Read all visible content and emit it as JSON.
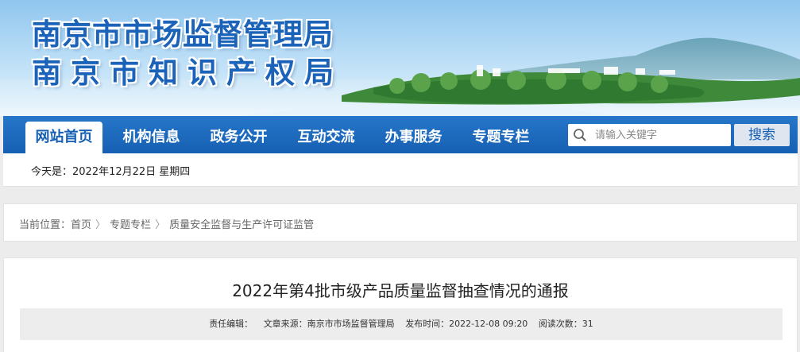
{
  "header": {
    "title_line1": "南京市市场监督管理局",
    "title_line2": "南京市知识产权局"
  },
  "nav": {
    "items": [
      {
        "label": "网站首页",
        "active": true
      },
      {
        "label": "机构信息",
        "active": false
      },
      {
        "label": "政务公开",
        "active": false
      },
      {
        "label": "互动交流",
        "active": false
      },
      {
        "label": "办事服务",
        "active": false
      },
      {
        "label": "专题专栏",
        "active": false
      }
    ],
    "search_placeholder": "请输入关键字",
    "search_button": "搜索"
  },
  "datebar": {
    "text": "今天是：2022年12月22日 星期四"
  },
  "breadcrumb": {
    "prefix": "当前位置：",
    "items": [
      "首页",
      "专题专栏",
      "质量安全监督与生产许可证监管"
    ],
    "separator": "〉"
  },
  "article": {
    "title": "2022年第4批市级产品质量监督抽查情况的通报",
    "editor_label": "责任编辑：",
    "source": "文章来源：南京市市场监督管理局",
    "published": "发布时间：2022-12-08 09:20",
    "views": "阅读次数：31"
  },
  "colors": {
    "nav_blue": "#1660b3",
    "title_blue": "#1b63b9"
  }
}
